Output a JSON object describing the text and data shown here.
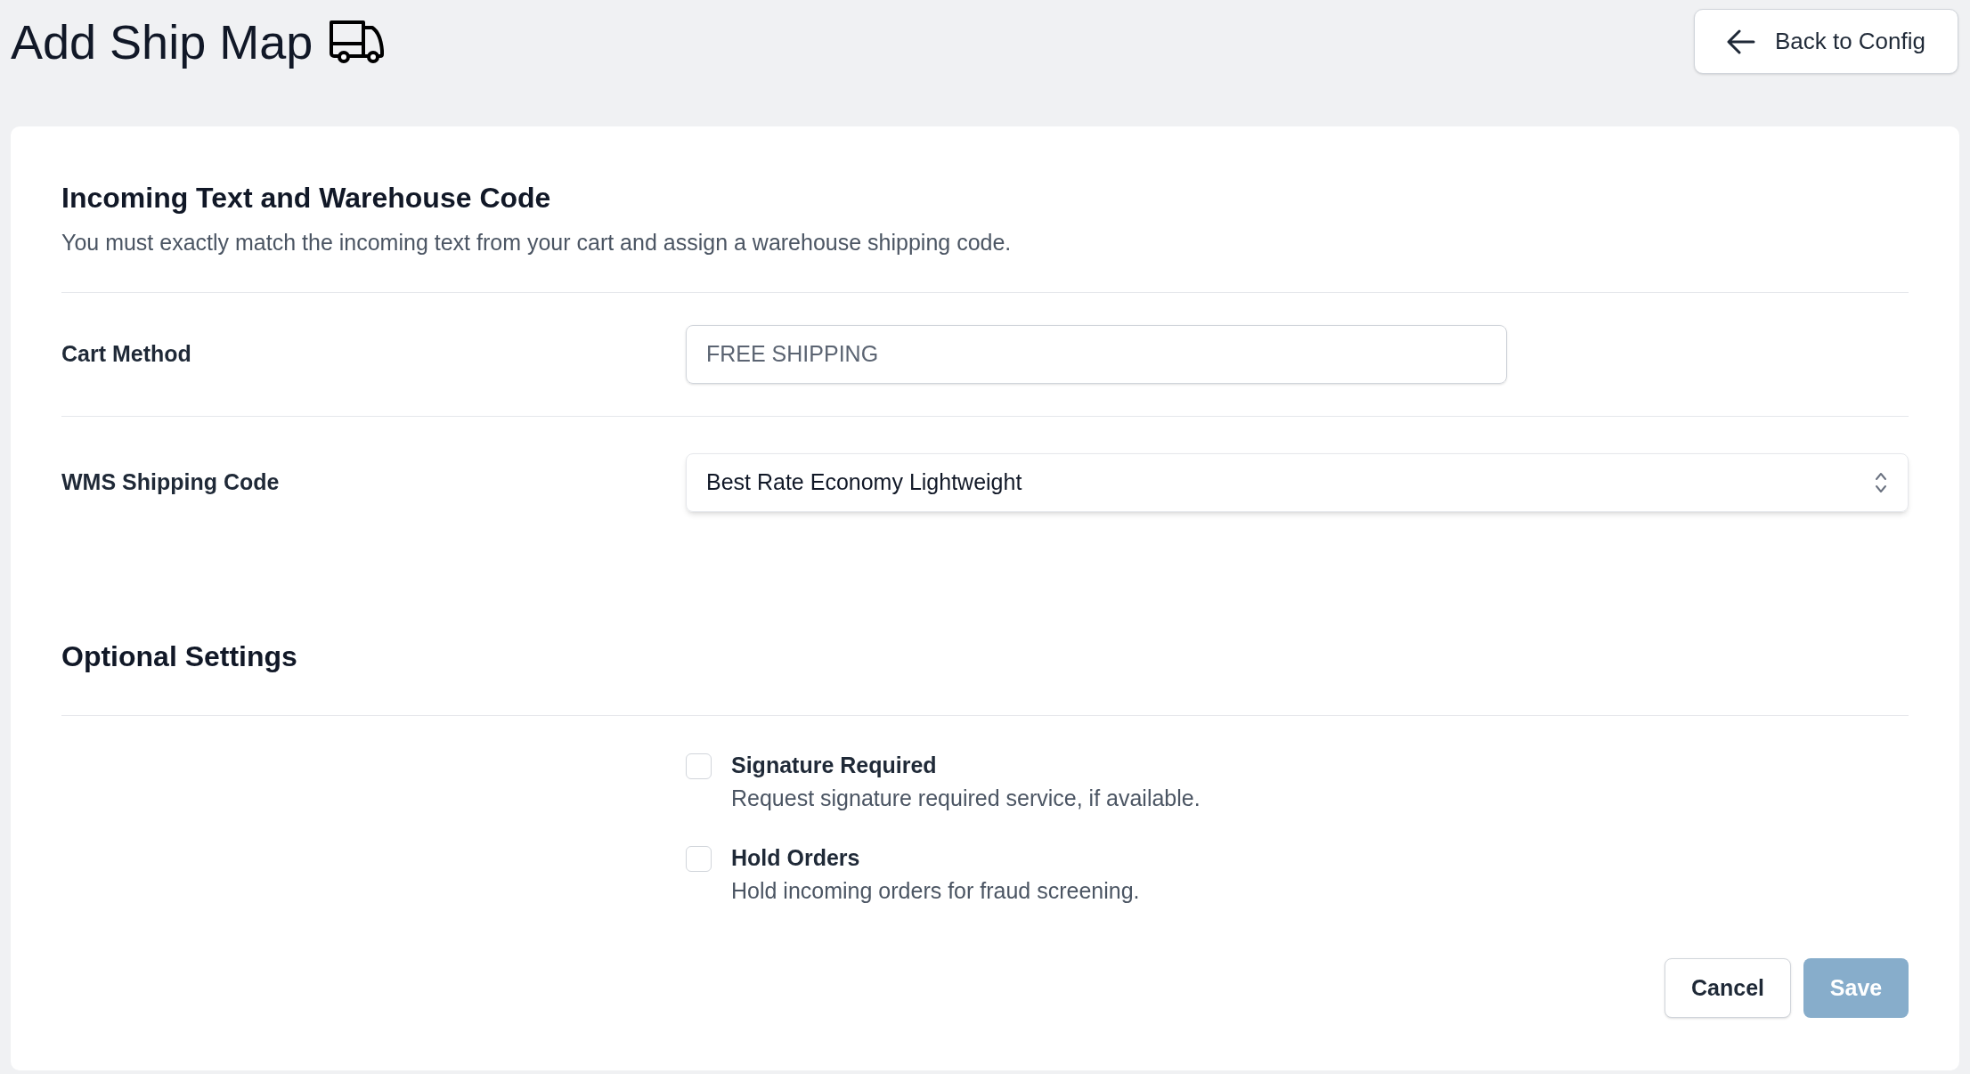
{
  "header": {
    "title": "Add Ship Map",
    "back_button": "Back to Config"
  },
  "section_main": {
    "title": "Incoming Text and Warehouse Code",
    "description": "You must exactly match the incoming text from your cart and assign a warehouse shipping code.",
    "fields": [
      {
        "kind": "input",
        "label": "Cart Method",
        "value": "FREE SHIPPING"
      },
      {
        "kind": "select",
        "label": "WMS Shipping Code",
        "value": "Best Rate Economy Lightweight"
      }
    ]
  },
  "section_optional": {
    "title": "Optional Settings",
    "options": [
      {
        "label": "Signature Required",
        "description": "Request signature required service, if available.",
        "checked": false
      },
      {
        "label": "Hold Orders",
        "description": "Hold incoming orders for fraud screening.",
        "checked": false
      }
    ]
  },
  "actions": [
    {
      "kind": "secondary",
      "label": "Cancel",
      "disabled": false
    },
    {
      "kind": "primary",
      "label": "Save",
      "disabled": true
    }
  ]
}
